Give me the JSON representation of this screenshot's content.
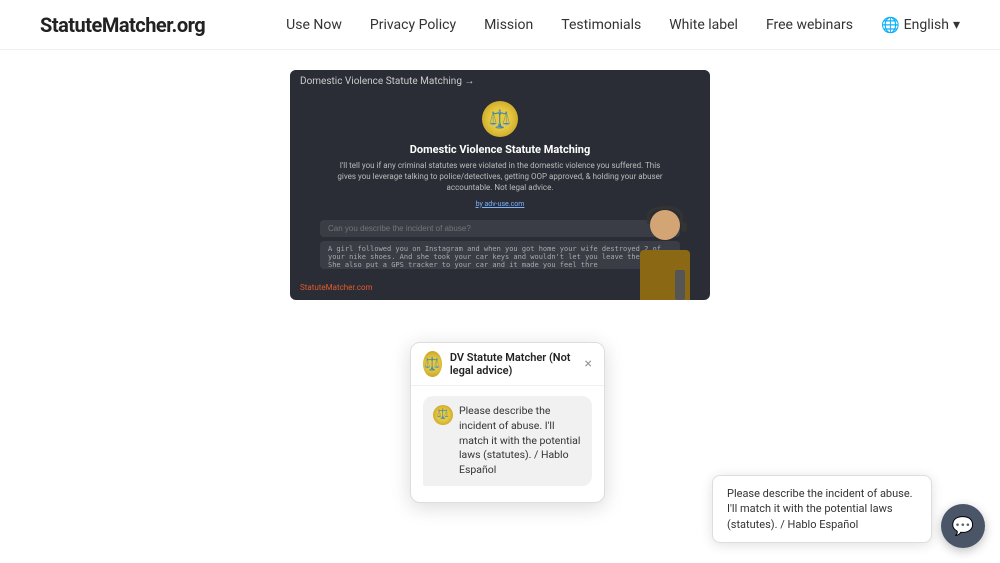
{
  "header": {
    "logo": "StatuteMatcher.org",
    "nav": {
      "items": [
        {
          "label": "Use Now",
          "href": "#"
        },
        {
          "label": "Privacy Policy",
          "href": "#"
        },
        {
          "label": "Mission",
          "href": "#"
        },
        {
          "label": "Testimonials",
          "href": "#"
        },
        {
          "label": "White label",
          "href": "#"
        },
        {
          "label": "Free webinars",
          "href": "#"
        }
      ]
    },
    "language": {
      "label": "English",
      "icon": "globe-icon"
    }
  },
  "video_preview": {
    "topbar_title": "Domestic Violence Statute Matching →",
    "scales_emoji": "⚖️",
    "title": "Domestic Violence Statute Matching",
    "description": "I'll tell you if any criminal statutes were violated in the domestic violence you suffered. This gives you leverage talking to police/detectives, getting OOP approved, & holding your abuser accountable. Not legal advice.",
    "link_text": "by adv-use.com",
    "input_placeholder": "Can you describe the incident of abuse?",
    "textarea_placeholder": "A girl followed you on Instagram and when you got home your wife destroyed 2 of your nike shoes. And she took your car keys and wouldn't let you leave the house. She also put a GPS tracker to your car and it made you feel thre",
    "watermark_text": "Statute",
    "watermark_highlight": "Matcher",
    "watermark_suffix": ".com"
  },
  "chat_widget": {
    "header_title": "DV Statute Matcher (Not legal advice)",
    "avatar_emoji": "⚖️",
    "close_label": "×",
    "message_text": "Please describe the incident of abuse. I'll match it with the potential laws (statutes). / Hablo Español",
    "message_avatar_emoji": "⚖️"
  },
  "tooltip": {
    "text": "Please describe the incident of abuse. I'll match it with the potential laws (statutes). / Hablo Español"
  },
  "fab": {
    "icon": "chat-bubble-icon",
    "symbol": "💬"
  }
}
